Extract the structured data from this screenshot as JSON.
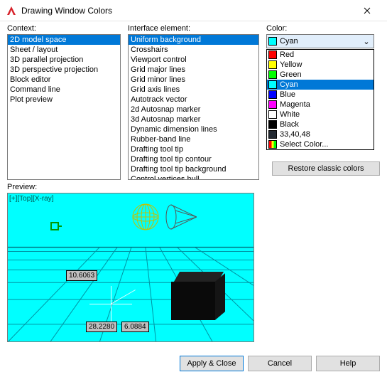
{
  "window": {
    "title": "Drawing Window Colors"
  },
  "labels": {
    "context": "Context:",
    "interface": "Interface element:",
    "color": "Color:",
    "preview": "Preview:"
  },
  "context_items": [
    "2D model space",
    "Sheet / layout",
    "3D parallel projection",
    "3D perspective projection",
    "Block editor",
    "Command line",
    "Plot preview"
  ],
  "context_selected": 0,
  "interface_items": [
    "Uniform background",
    "Crosshairs",
    "Viewport control",
    "Grid major lines",
    "Grid minor lines",
    "Grid axis lines",
    "Autotrack vector",
    "2d Autosnap marker",
    "3d Autosnap marker",
    "Dynamic dimension lines",
    "Rubber-band line",
    "Drafting tool tip",
    "Drafting tool tip contour",
    "Drafting tool tip background",
    "Control vertices hull"
  ],
  "interface_selected": 0,
  "color_combo": {
    "selected_label": "Cyan",
    "selected_hex": "#00ffff"
  },
  "color_options": [
    {
      "label": "Red",
      "hex": "#ff0000"
    },
    {
      "label": "Yellow",
      "hex": "#ffff00"
    },
    {
      "label": "Green",
      "hex": "#00ff00"
    },
    {
      "label": "Cyan",
      "hex": "#00ffff",
      "selected": true
    },
    {
      "label": "Blue",
      "hex": "#0000ff"
    },
    {
      "label": "Magenta",
      "hex": "#ff00ff"
    },
    {
      "label": "White",
      "hex": "#ffffff"
    },
    {
      "label": "Black",
      "hex": "#000000"
    },
    {
      "label": "33,40,48",
      "hex": "#212830"
    },
    {
      "label": "Select Color...",
      "multi": true
    }
  ],
  "buttons": {
    "restore_classic": "Restore classic colors",
    "apply_close": "Apply & Close",
    "cancel": "Cancel",
    "help": "Help"
  },
  "preview": {
    "top_left": "[+][Top][X-ray]",
    "coord1": "10.6063",
    "coord2": "28.2280",
    "coord3": "6.0884"
  }
}
